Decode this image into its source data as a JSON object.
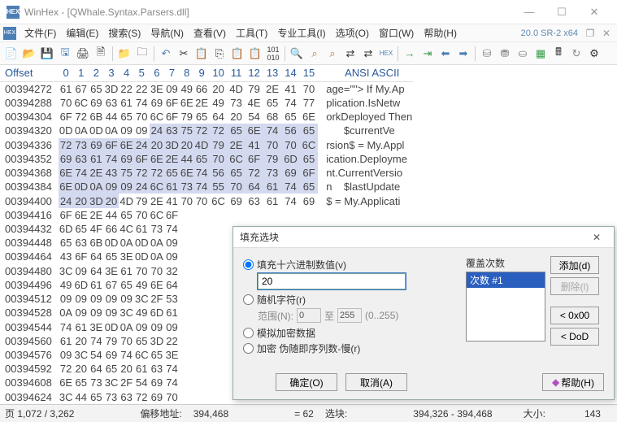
{
  "window": {
    "title": "WinHex - [QWhale.Syntax.Parsers.dll]",
    "version": "20.0 SR-2 x64"
  },
  "menus": [
    "文件(F)",
    "编辑(E)",
    "搜索(S)",
    "导航(N)",
    "查看(V)",
    "工具(T)",
    "专业工具(I)",
    "选项(O)",
    "窗口(W)",
    "帮助(H)"
  ],
  "hex": {
    "offset_header": "Offset",
    "col_headers": [
      "0",
      "1",
      "2",
      "3",
      "4",
      "5",
      "6",
      "7",
      "8",
      "9",
      "10",
      "11",
      "12",
      "13",
      "14",
      "15"
    ],
    "ascii_header": "ANSI ASCII",
    "rows": [
      {
        "off": "00394272",
        "b": [
          "61",
          "67",
          "65",
          "3D",
          "22",
          "22",
          "3E",
          "09",
          "49",
          "66",
          "20",
          "4D",
          "79",
          "2E",
          "41",
          "70"
        ],
        "a": "age=\"\"> If My.Ap"
      },
      {
        "off": "00394288",
        "b": [
          "70",
          "6C",
          "69",
          "63",
          "61",
          "74",
          "69",
          "6F",
          "6E",
          "2E",
          "49",
          "73",
          "4E",
          "65",
          "74",
          "77"
        ],
        "a": "plication.IsNetw"
      },
      {
        "off": "00394304",
        "b": [
          "6F",
          "72",
          "6B",
          "44",
          "65",
          "70",
          "6C",
          "6F",
          "79",
          "65",
          "64",
          "20",
          "54",
          "68",
          "65",
          "6E"
        ],
        "a": "orkDeployed Then"
      },
      {
        "off": "00394320",
        "b": [
          "0D",
          "0A",
          "0D",
          "0A",
          "09",
          "09",
          "24",
          "63",
          "75",
          "72",
          "72",
          "65",
          "6E",
          "74",
          "56",
          "65"
        ],
        "a": "      $currentVe",
        "sel": [
          6,
          15
        ]
      },
      {
        "off": "00394336",
        "b": [
          "72",
          "73",
          "69",
          "6F",
          "6E",
          "24",
          "20",
          "3D",
          "20",
          "4D",
          "79",
          "2E",
          "41",
          "70",
          "70",
          "6C"
        ],
        "a": "rsion$ = My.Appl",
        "sel": [
          0,
          15
        ]
      },
      {
        "off": "00394352",
        "b": [
          "69",
          "63",
          "61",
          "74",
          "69",
          "6F",
          "6E",
          "2E",
          "44",
          "65",
          "70",
          "6C",
          "6F",
          "79",
          "6D",
          "65"
        ],
        "a": "ication.Deployme",
        "sel": [
          0,
          15
        ]
      },
      {
        "off": "00394368",
        "b": [
          "6E",
          "74",
          "2E",
          "43",
          "75",
          "72",
          "72",
          "65",
          "6E",
          "74",
          "56",
          "65",
          "72",
          "73",
          "69",
          "6F"
        ],
        "a": "nt.CurrentVersio",
        "sel": [
          0,
          15
        ]
      },
      {
        "off": "00394384",
        "b": [
          "6E",
          "0D",
          "0A",
          "09",
          "09",
          "24",
          "6C",
          "61",
          "73",
          "74",
          "55",
          "70",
          "64",
          "61",
          "74",
          "65"
        ],
        "a": "n    $lastUpdate",
        "sel": [
          0,
          15
        ]
      },
      {
        "off": "00394400",
        "b": [
          "24",
          "20",
          "3D",
          "20",
          "4D",
          "79",
          "2E",
          "41",
          "70",
          "70",
          "6C",
          "69",
          "63",
          "61",
          "74",
          "69"
        ],
        "a": "$ = My.Applicati",
        "sel": [
          0,
          3
        ]
      },
      {
        "off": "00394416",
        "b": [
          "6F",
          "6E",
          "2E",
          "44",
          "65",
          "70",
          "6C",
          "6F"
        ],
        "a": ""
      },
      {
        "off": "00394432",
        "b": [
          "6D",
          "65",
          "4F",
          "66",
          "4C",
          "61",
          "73",
          "74"
        ],
        "a": ""
      },
      {
        "off": "00394448",
        "b": [
          "65",
          "63",
          "6B",
          "0D",
          "0A",
          "0D",
          "0A",
          "09"
        ],
        "a": ""
      },
      {
        "off": "00394464",
        "b": [
          "43",
          "6F",
          "64",
          "65",
          "3E",
          "0D",
          "0A",
          "09"
        ],
        "a": ""
      },
      {
        "off": "00394480",
        "b": [
          "3C",
          "09",
          "64",
          "3E",
          "61",
          "70",
          "70",
          "32"
        ],
        "a": ""
      },
      {
        "off": "00394496",
        "b": [
          "49",
          "6D",
          "61",
          "67",
          "65",
          "49",
          "6E",
          "64"
        ],
        "a": ""
      },
      {
        "off": "00394512",
        "b": [
          "09",
          "09",
          "09",
          "09",
          "09",
          "3C",
          "2F",
          "53"
        ],
        "a": ""
      },
      {
        "off": "00394528",
        "b": [
          "0A",
          "09",
          "09",
          "09",
          "3C",
          "49",
          "6D",
          "61"
        ],
        "a": ""
      },
      {
        "off": "00394544",
        "b": [
          "74",
          "61",
          "3E",
          "0D",
          "0A",
          "09",
          "09",
          "09"
        ],
        "a": ""
      },
      {
        "off": "00394560",
        "b": [
          "61",
          "20",
          "74",
          "79",
          "70",
          "65",
          "3D",
          "22"
        ],
        "a": ""
      },
      {
        "off": "00394576",
        "b": [
          "09",
          "3C",
          "54",
          "69",
          "74",
          "6C",
          "65",
          "3E"
        ],
        "a": ""
      },
      {
        "off": "00394592",
        "b": [
          "72",
          "20",
          "64",
          "65",
          "20",
          "61",
          "63",
          "74"
        ],
        "a": ""
      },
      {
        "off": "00394608",
        "b": [
          "6E",
          "65",
          "73",
          "3C",
          "2F",
          "54",
          "69",
          "74"
        ],
        "a": ""
      },
      {
        "off": "00394624",
        "b": [
          "3C",
          "44",
          "65",
          "73",
          "63",
          "72",
          "69",
          "70"
        ],
        "a": ""
      }
    ]
  },
  "status": {
    "page": "页 1,072 / 3,262",
    "offset_addr_label": "偏移地址:",
    "offset_addr_value": "394,468",
    "eq": "= 62",
    "sel_label": "选块:",
    "sel_value": "394,326 - 394,468",
    "size_label": "大小:",
    "size_value": "143"
  },
  "dialog": {
    "title": "填充选块",
    "opt_hex": "填充十六进制数值(v)",
    "hex_value": "20",
    "opt_random": "随机字符(r)",
    "range_label": "范围(N):",
    "range_from": "0",
    "range_to_label": "至",
    "range_to": "255",
    "range_hint": "(0..255)",
    "opt_sim": "模拟加密数据",
    "opt_enc": "加密 伪随即序列数-慢(r)",
    "overwrite_label": "覆盖次数",
    "list_item": "次数 #1",
    "btn_add": "添加(d)",
    "btn_del": "删除(l)",
    "btn_0x00": "< 0x00",
    "btn_dod": "< DoD",
    "btn_ok": "确定(O)",
    "btn_cancel": "取消(A)",
    "btn_help": "帮助(H)"
  }
}
